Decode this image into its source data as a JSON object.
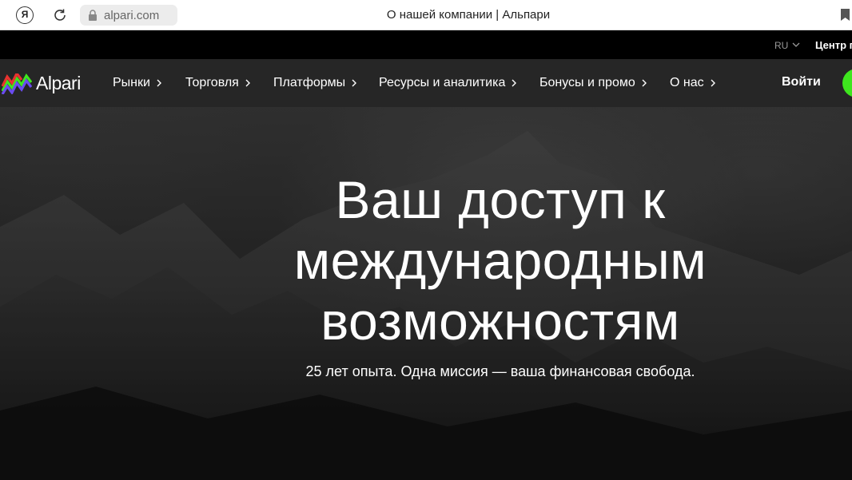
{
  "browser": {
    "yandex_label": "Я",
    "url": "alpari.com",
    "page_title": "О нашей компании | Альпари"
  },
  "util_bar": {
    "language": "RU",
    "help_center": "Центр п"
  },
  "nav": {
    "logo_text": "Alpari",
    "items": [
      {
        "label": "Рынки"
      },
      {
        "label": "Торговля"
      },
      {
        "label": "Платформы"
      },
      {
        "label": "Ресурсы и аналитика"
      },
      {
        "label": "Бонусы и промо"
      },
      {
        "label": "О нас"
      }
    ],
    "login": "Войти"
  },
  "hero": {
    "title_lines": [
      "Ваш доступ к",
      "международным",
      "возможностям"
    ],
    "subtitle": "25 лет опыта. Одна миссия — ваша финансовая свобода."
  },
  "colors": {
    "accent_green": "#3ee61e",
    "nav_bg": "#262626",
    "util_bg": "#000000"
  }
}
